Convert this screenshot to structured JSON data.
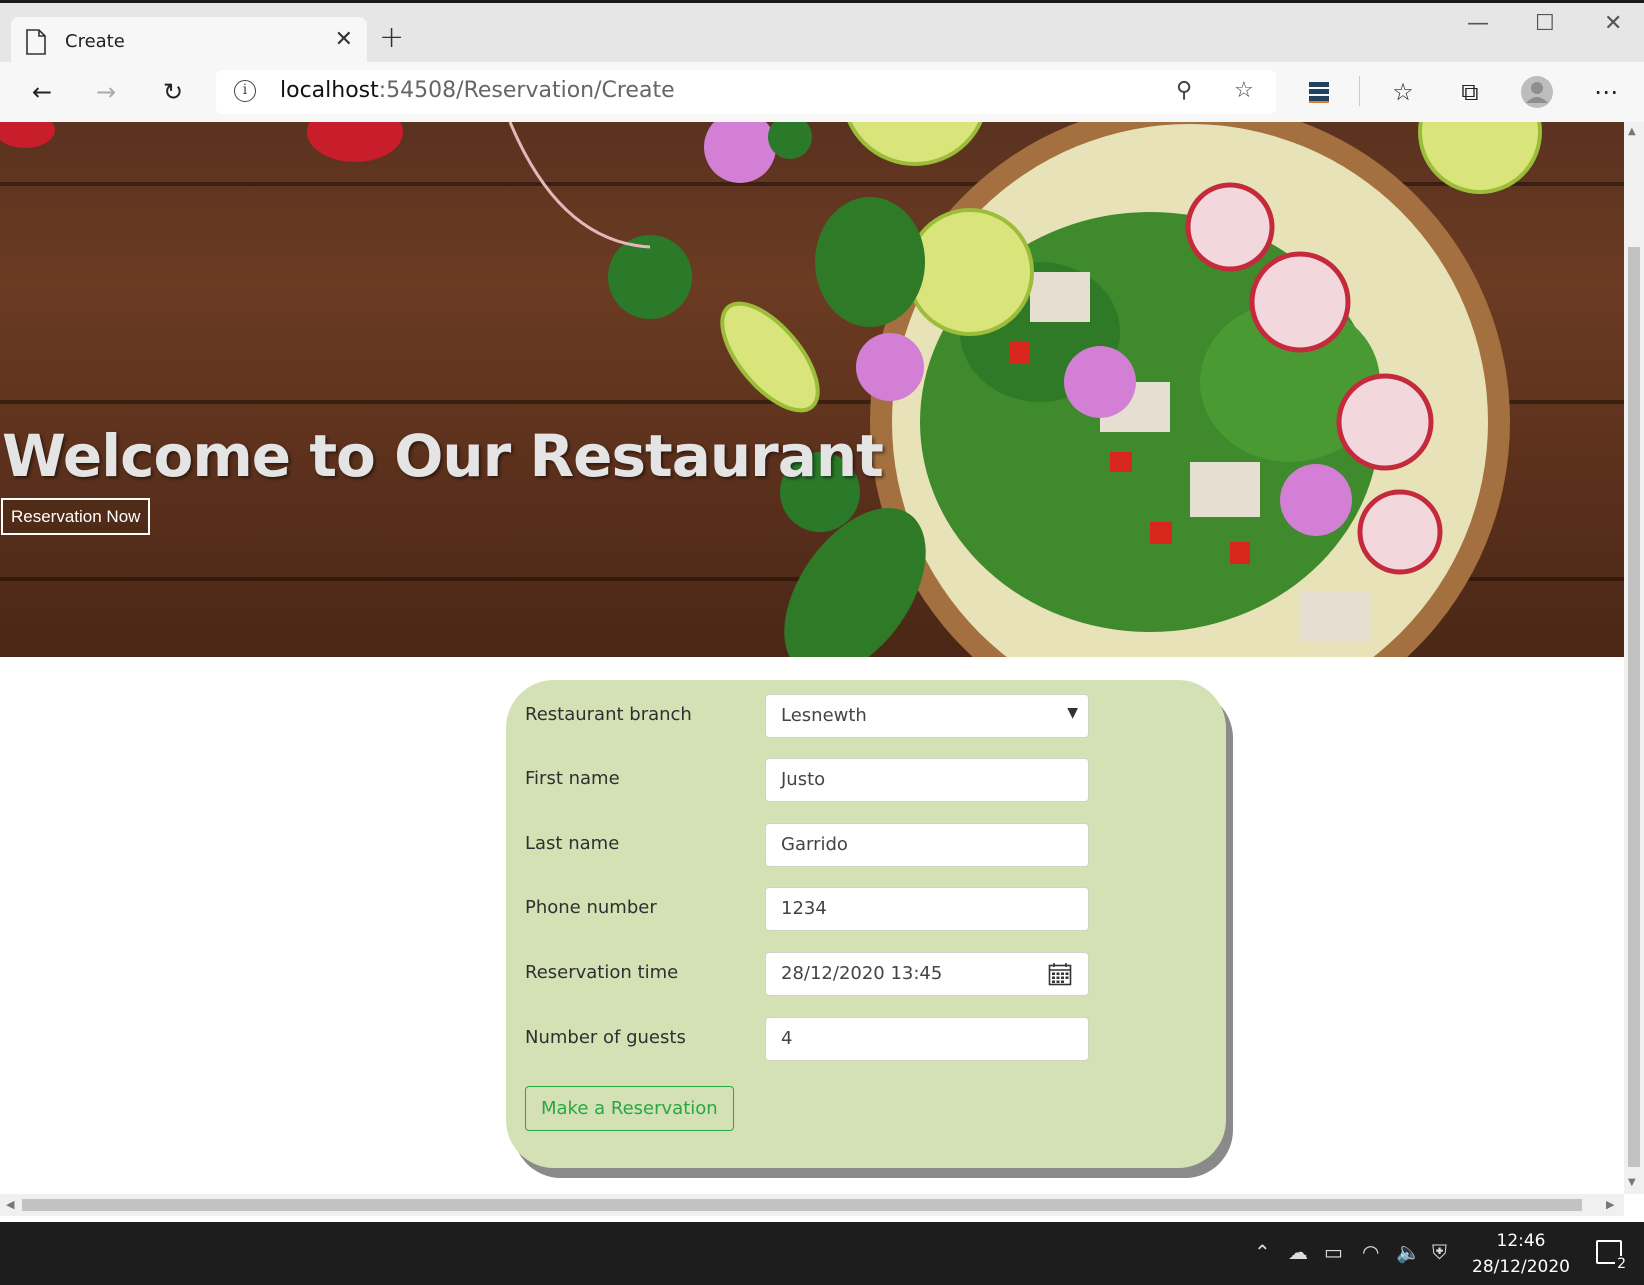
{
  "browser": {
    "tab_title": "Create",
    "new_tab_symbol": "+",
    "url_host": "localhost",
    "url_rest": ":54508/Reservation/Create"
  },
  "hero": {
    "title": "Welcome to Our Restaurant",
    "button_label": "Reservation Now"
  },
  "form": {
    "branch_label": "Restaurant branch",
    "branch_value": "Lesnewth",
    "first_name_label": "First name",
    "first_name_value": "Justo",
    "last_name_label": "Last name",
    "last_name_value": "Garrido",
    "phone_label": "Phone number",
    "phone_value": "1234",
    "time_label": "Reservation time",
    "time_value": "28/12/2020 13:45",
    "guests_label": "Number of guests",
    "guests_value": "4",
    "submit_label": "Make a Reservation"
  },
  "taskbar": {
    "time": "12:46",
    "date": "28/12/2020",
    "notification_count": "2"
  },
  "colors": {
    "card_bg": "#d4e1b5",
    "submit_accent": "#28a745",
    "taskbar_bg": "#1d1d1d"
  }
}
